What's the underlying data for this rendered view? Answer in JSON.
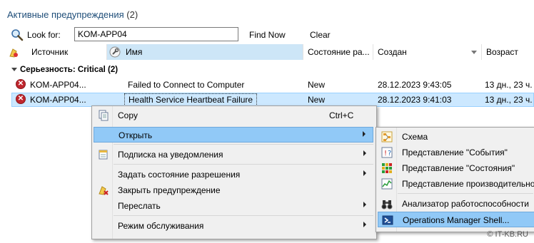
{
  "header": {
    "title": "Активные предупреждения",
    "count": "(2)"
  },
  "search": {
    "label": "Look for:",
    "value": "KOM-APP04",
    "find_now": "Find Now",
    "clear": "Clear"
  },
  "columns": [
    "Источник",
    "Имя",
    "Состояние ра...",
    "Создан",
    "Возраст"
  ],
  "group": "Серьезность: Critical (2)",
  "rows": [
    {
      "source": "KOM-APP04...",
      "name": "Failed to Connect to Computer",
      "state": "New",
      "created": "28.12.2023 9:43:05",
      "age": "13 дн., 23 ч."
    },
    {
      "source": "KOM-APP04...",
      "name": "Health Service Heartbeat Failure",
      "state": "New",
      "created": "28.12.2023 9:41:03",
      "age": "13 дн., 23 ч."
    }
  ],
  "context_menu": {
    "copy": "Copy",
    "copy_shortcut": "Ctrl+C",
    "open": "Открыть",
    "subscribe": "Подписка на уведомления",
    "set_resolution": "Задать состояние разрешения",
    "close_alert": "Закрыть предупреждение",
    "forward": "Переслать",
    "maintenance": "Режим обслуживания"
  },
  "submenu": {
    "diagram": "Схема",
    "events_view": "Представление \"События\"",
    "state_view": "Представление \"Состояния\"",
    "perf_view": "Представление производительно",
    "perf_analyzer": "Анализатор работоспособности",
    "om_shell": "Operations Manager Shell..."
  },
  "watermark": "© IT-KB.RU"
}
